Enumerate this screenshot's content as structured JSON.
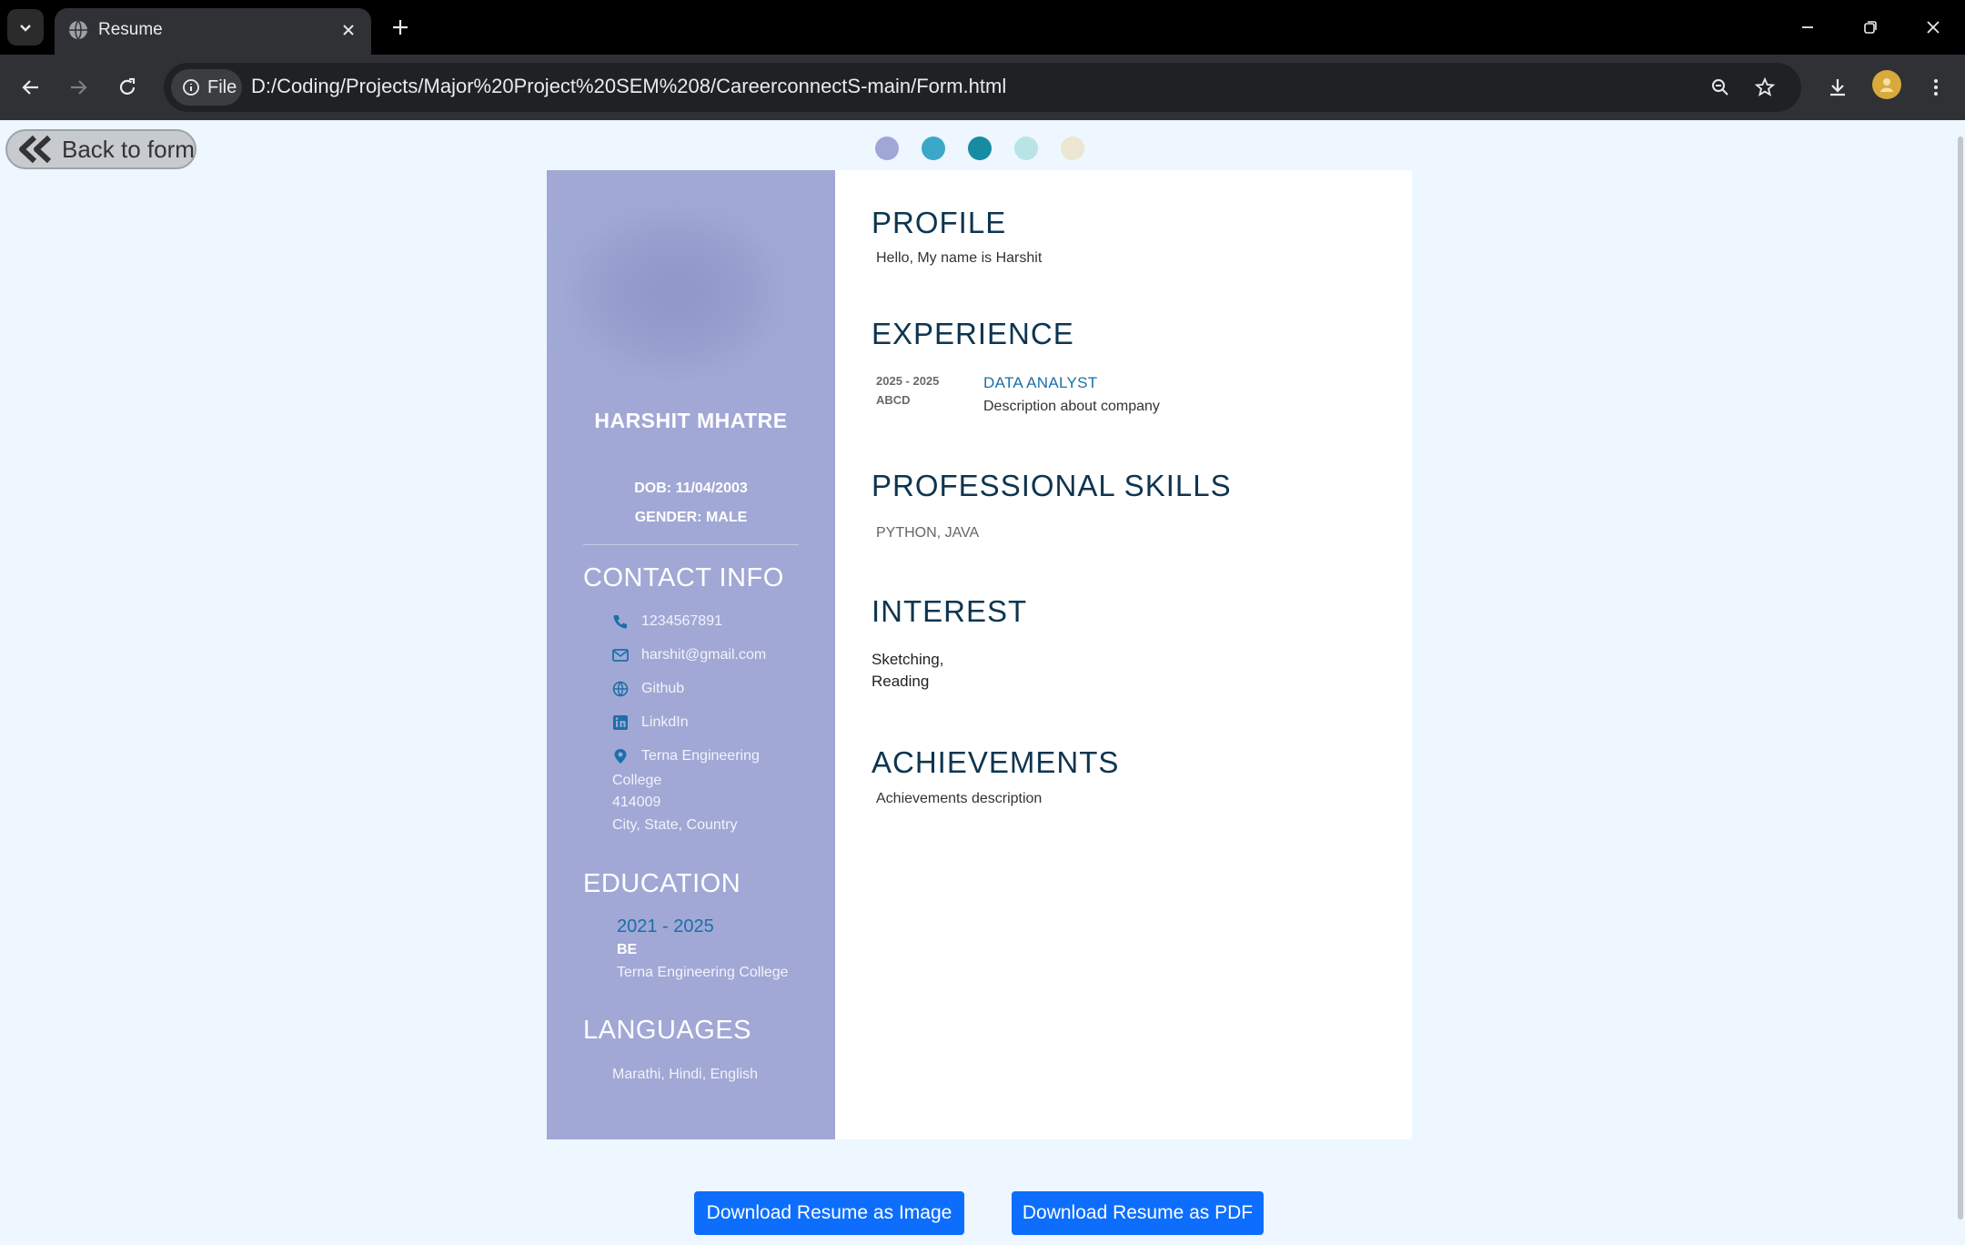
{
  "browser": {
    "tab_title": "Resume",
    "site_chip_label": "File",
    "url": "D:/Coding/Projects/Major%20Project%20SEM%208/CareerconnectS-main/Form.html"
  },
  "page": {
    "back_button_label": "Back to form",
    "theme_swatches": [
      "#a0a6d6",
      "#3aa8c6",
      "#178ca0",
      "#b9e4e6",
      "#ece6d2"
    ],
    "download_image_label": "Download Resume as Image",
    "download_pdf_label": "Download Resume as PDF"
  },
  "resume": {
    "name": "HARSHIT MHATRE",
    "dob": "DOB: 11/04/2003",
    "gender": "GENDER: MALE",
    "contact_heading": "CONTACT INFO",
    "contact": {
      "phone": "1234567891",
      "email": "harshit@gmail.com",
      "github": "Github",
      "linkedin": "LinkdIn",
      "address_line1": "Terna Engineering",
      "address_line2": "College",
      "address_line3": "414009",
      "address_line4": "City, State, Country"
    },
    "education_heading": "EDUCATION",
    "education": {
      "years": "2021 - 2025",
      "degree": "BE",
      "school": "Terna Engineering College"
    },
    "languages_heading": "LANGUAGES",
    "languages": "Marathi, Hindi, English",
    "profile_heading": "PROFILE",
    "profile_text": "Hello, My name is Harshit",
    "experience_heading": "EXPERIENCE",
    "experience": {
      "years": "2025 - 2025",
      "company": "ABCD",
      "role": "DATA ANALYST",
      "description": "Description about company"
    },
    "skills_heading": "PROFESSIONAL SKILLS",
    "skills": "PYTHON, JAVA",
    "interest_heading": "INTEREST",
    "interests": [
      "Sketching,",
      "Reading"
    ],
    "achievements_heading": "ACHIEVEMENTS",
    "achievements_text": "Achievements description"
  }
}
